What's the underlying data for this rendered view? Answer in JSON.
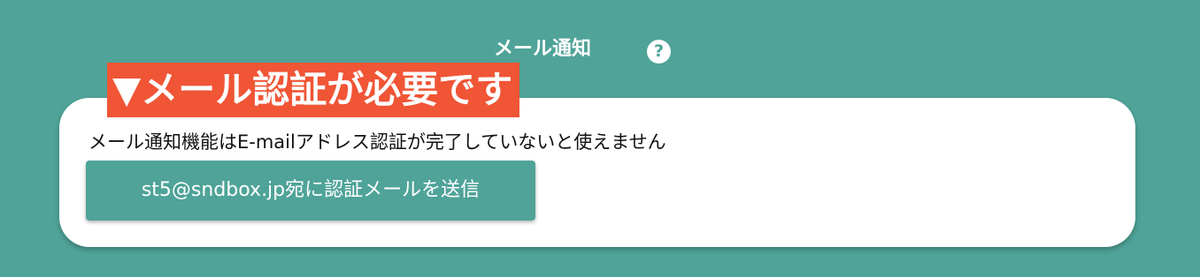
{
  "header": {
    "title": "メール通知",
    "help_icon": "question-circle-icon",
    "help_glyph": "?"
  },
  "banner": {
    "text": "▼メール認証が必要です"
  },
  "card": {
    "description": "メール通知機能はE-mailアドレス認証が完了していないと使えません",
    "send_button_label": "st5@sndbox.jp宛に認証メールを送信"
  },
  "colors": {
    "background": "#4fa398",
    "banner": "#f05535",
    "card": "#ffffff",
    "button": "#4fa398"
  }
}
